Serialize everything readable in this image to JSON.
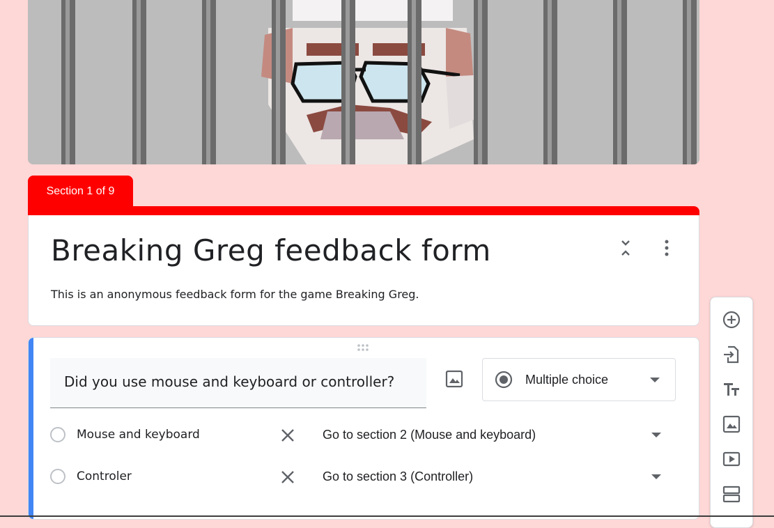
{
  "section_tab": {
    "label": "Section 1 of 9"
  },
  "form": {
    "title": "Breaking Greg feedback form",
    "description": "This is an anonymous feedback form for the game Breaking Greg."
  },
  "question": {
    "text": "Did you use mouse and keyboard or controller?",
    "type": "Multiple choice",
    "options": [
      {
        "label": "Mouse and keyboard",
        "goto": "Go to section 2 (Mouse and keyboard)"
      },
      {
        "label": "Controler",
        "goto": "Go to section 3 (Controller)"
      }
    ]
  },
  "toolbar": {
    "icons": [
      "add-question-icon",
      "import-questions-icon",
      "add-title-icon",
      "add-image-icon",
      "add-video-icon",
      "add-section-icon"
    ]
  },
  "colors": {
    "background": "#fed7d7",
    "section_accent": "#ff0000",
    "question_accent": "#4285f4"
  }
}
